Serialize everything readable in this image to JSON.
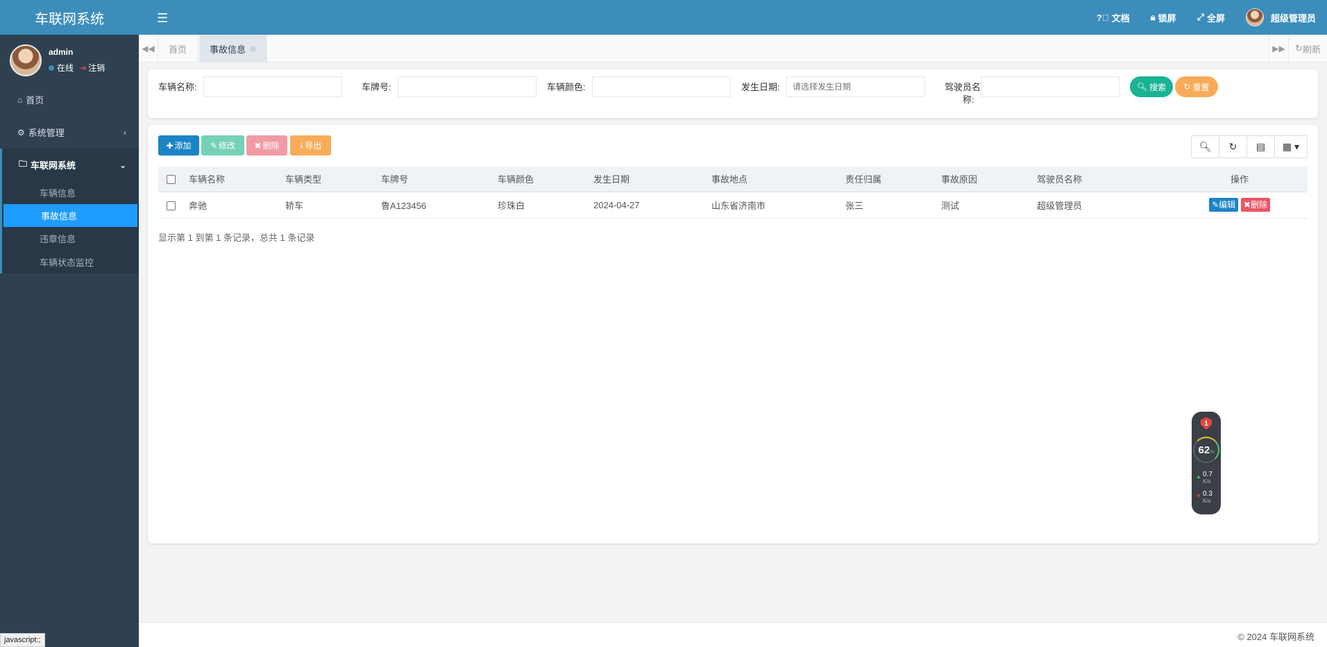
{
  "app": {
    "brand": "车联网系统"
  },
  "user": {
    "name": "admin",
    "status_online": "在线",
    "logout": "注销"
  },
  "header": {
    "docs": "文档",
    "lock": "锁屏",
    "fullscreen": "全屏",
    "user_display": "超级管理员"
  },
  "sidebar": {
    "home": "首页",
    "system": "系统管理",
    "iov_group": "车联网系统",
    "sub_items": [
      {
        "label": "车辆信息"
      },
      {
        "label": "事故信息"
      },
      {
        "label": "违章信息"
      },
      {
        "label": "车辆状态监控"
      }
    ],
    "active_index": 1
  },
  "tabs": {
    "home": "首页",
    "active": "事故信息",
    "refresh": "刷新"
  },
  "search": {
    "vehicle_name_label": "车辆名称:",
    "plate_label": "车牌号:",
    "color_label": "车辆颜色:",
    "date_label": "发生日期:",
    "date_placeholder": "请选择发生日期",
    "driver_label_1": "驾驶员名",
    "driver_label_2": "称:",
    "search_button": "搜索",
    "reset_button": "重置"
  },
  "toolbar": {
    "add": "添加",
    "edit": "修改",
    "delete": "删除",
    "export": "导出"
  },
  "table": {
    "columns": [
      "车辆名称",
      "车辆类型",
      "车牌号",
      "车辆颜色",
      "发生日期",
      "事故地点",
      "责任归属",
      "事故原因",
      "驾驶员名称",
      "操作"
    ],
    "rows": [
      {
        "vehicle_name": "奔驰",
        "vehicle_type": "轿车",
        "plate": "鲁A123456",
        "color": "珍珠白",
        "date": "2024-04-27",
        "location": "山东省济南市",
        "responsible": "张三",
        "reason": "测试",
        "driver": "超级管理员",
        "edit": "编辑",
        "delete": "删除"
      }
    ],
    "pager_info": "显示第 1 到第 1 条记录，总共 1 条记录"
  },
  "footer": {
    "copyright": "© 2024 车联网系统"
  },
  "widget": {
    "badge": "1",
    "percent": "62",
    "percent_unit": "%",
    "up_value": "0.7",
    "up_unit": "K/s",
    "down_value": "0.3",
    "down_unit": "K/s"
  },
  "statusbar": {
    "text": "javascript:;"
  },
  "colors": {
    "header_bg": "#3c8dbc",
    "sidebar_bg": "#2f4050",
    "active_item": "#1e9cff",
    "add_btn": "#1c84c6",
    "edit_btn": "#75d1b6",
    "delete_btn": "#f19aa6",
    "export_btn": "#f8ac59",
    "search_btn": "#1ab394",
    "reset_btn": "#f8ac59",
    "row_edit": "#1c84c6",
    "row_delete": "#ed5565"
  }
}
